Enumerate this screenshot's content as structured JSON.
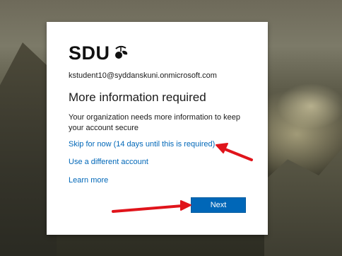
{
  "brand": {
    "logo_text": "SDU",
    "accent": "#0067b8",
    "arrow_color": "#e0141b"
  },
  "account": {
    "email": "kstudent10@syddanskuni.onmicrosoft.com"
  },
  "dialog": {
    "title": "More information required",
    "description": "Your organization needs more information to keep your account secure",
    "skip_link": "Skip for now (14 days until this is required)",
    "different_account_link": "Use a different account",
    "learn_more_link": "Learn more",
    "next_button": "Next"
  },
  "icons": [
    "sdu-leaf-icon",
    "red-arrow-annotation"
  ]
}
